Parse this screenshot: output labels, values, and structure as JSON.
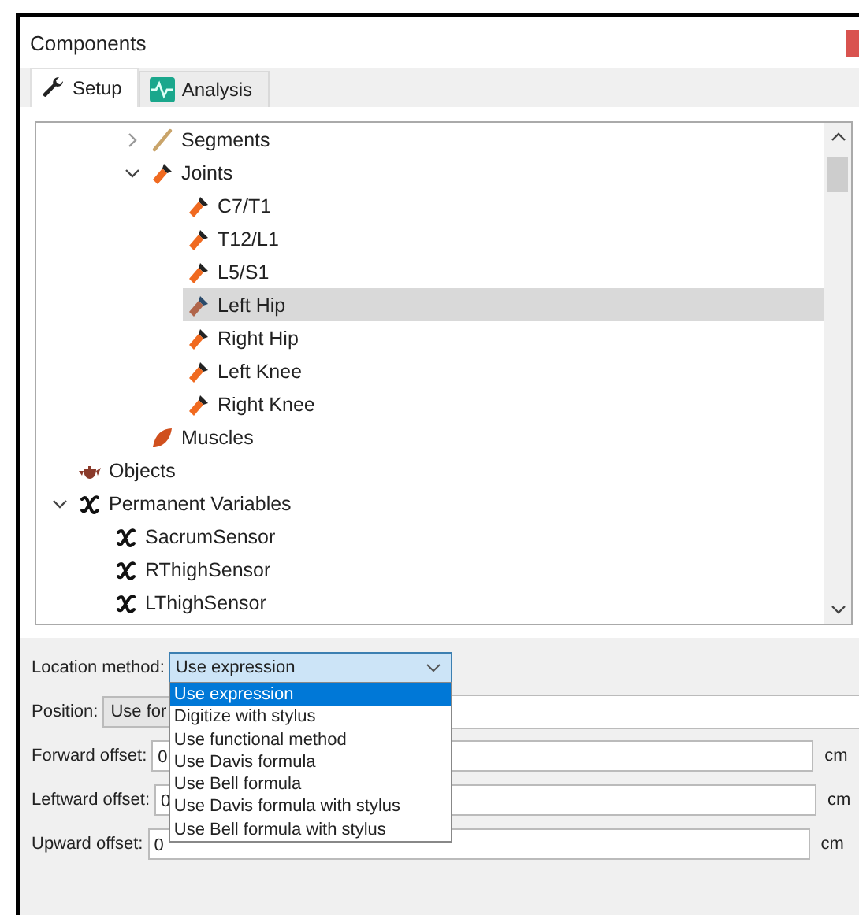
{
  "window": {
    "title": "Components"
  },
  "tabs": [
    {
      "label": "Setup",
      "selected": true
    },
    {
      "label": "Analysis",
      "selected": false
    }
  ],
  "tree": {
    "partial_branch": [
      {
        "label": "Segments",
        "kind": "segment",
        "expanded": false,
        "selected": false
      },
      {
        "label": "Joints",
        "kind": "joint",
        "expanded": true,
        "selected": false,
        "children": [
          {
            "label": "C7/T1",
            "kind": "joint",
            "selected": false
          },
          {
            "label": "T12/L1",
            "kind": "joint",
            "selected": false
          },
          {
            "label": "L5/S1",
            "kind": "joint",
            "selected": false
          },
          {
            "label": "Left Hip",
            "kind": "joint",
            "selected": true
          },
          {
            "label": "Right Hip",
            "kind": "joint",
            "selected": false
          },
          {
            "label": "Left Knee",
            "kind": "joint",
            "selected": false
          },
          {
            "label": "Right Knee",
            "kind": "joint",
            "selected": false
          }
        ]
      },
      {
        "label": "Muscles",
        "kind": "muscle",
        "selected": false
      }
    ],
    "items": [
      {
        "label": "Objects",
        "kind": "object",
        "selected": false
      },
      {
        "label": "Permanent Variables",
        "kind": "variable",
        "expanded": true,
        "selected": false,
        "children": [
          {
            "label": "SacrumSensor",
            "kind": "variable",
            "selected": false
          },
          {
            "label": "RThighSensor",
            "kind": "variable",
            "selected": false
          },
          {
            "label": "LThighSensor",
            "kind": "variable",
            "selected": false
          }
        ]
      }
    ]
  },
  "form": {
    "location_method": {
      "label": "Location method:",
      "value": "Use expression",
      "open": true,
      "options": [
        {
          "label": "Use expression",
          "selected": true
        },
        {
          "label": "Digitize with stylus",
          "selected": false
        },
        {
          "label": "Use functional method",
          "selected": false
        },
        {
          "label": "Use Davis formula",
          "selected": false
        },
        {
          "label": "Use Bell formula",
          "selected": false
        },
        {
          "label": "Use Davis formula with stylus",
          "selected": false
        },
        {
          "label": "Use Bell formula with stylus",
          "selected": false
        }
      ]
    },
    "position": {
      "label": "Position:",
      "value": "Use for"
    },
    "offsets": [
      {
        "label": "Forward offset:",
        "value": "0",
        "unit": "cm"
      },
      {
        "label": "Leftward offset:",
        "value": "0",
        "unit": "cm"
      },
      {
        "label": "Upward offset:",
        "value": "0",
        "unit": "cm"
      }
    ]
  }
}
